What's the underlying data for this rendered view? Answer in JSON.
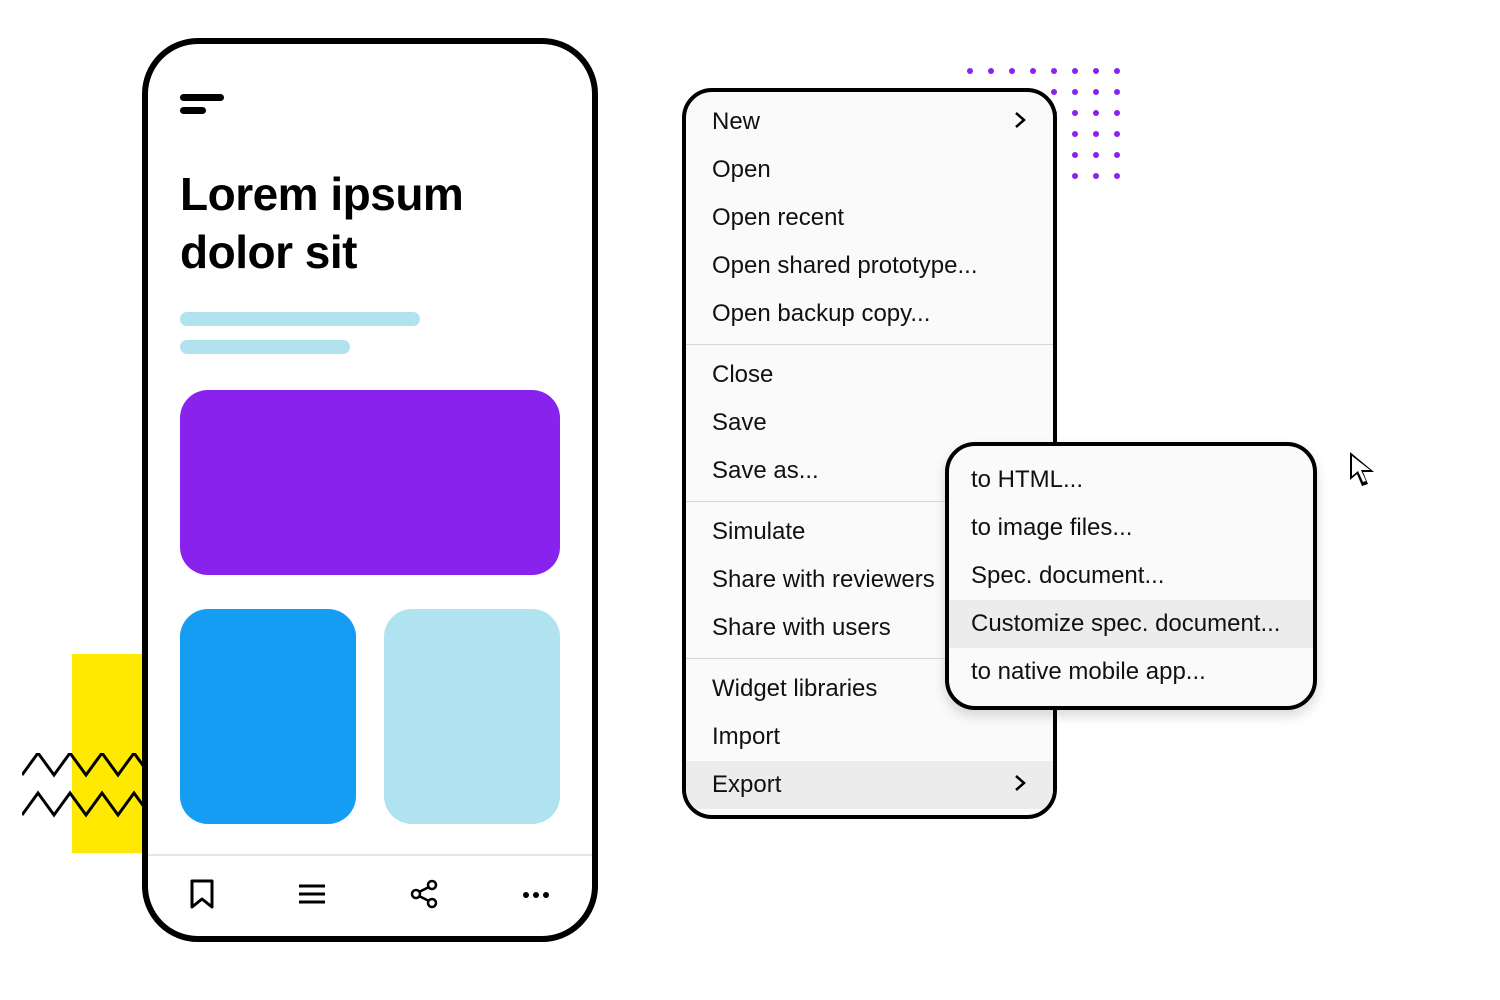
{
  "phone": {
    "title_line1": "Lorem ipsum",
    "title_line2": "dolor sit",
    "tabs": {
      "bookmark": "bookmark",
      "list": "list",
      "share": "share",
      "more": "more"
    }
  },
  "menu": {
    "groups": [
      {
        "items": [
          {
            "label": "New",
            "has_sub": true
          },
          {
            "label": "Open"
          },
          {
            "label": "Open recent"
          },
          {
            "label": "Open shared prototype..."
          },
          {
            "label": "Open backup copy..."
          }
        ]
      },
      {
        "items": [
          {
            "label": "Close"
          },
          {
            "label": "Save"
          },
          {
            "label": "Save as..."
          }
        ]
      },
      {
        "items": [
          {
            "label": "Simulate"
          },
          {
            "label": "Share with reviewers"
          },
          {
            "label": "Share with users"
          }
        ]
      },
      {
        "items": [
          {
            "label": "Widget libraries"
          },
          {
            "label": "Import"
          },
          {
            "label": "Export",
            "has_sub": true,
            "hover": true
          }
        ]
      }
    ]
  },
  "submenu": {
    "items": [
      {
        "label": "to HTML..."
      },
      {
        "label": "to image files..."
      },
      {
        "label": "Spec. document..."
      },
      {
        "label": "Customize spec. document...",
        "hover": true
      },
      {
        "label": "to native mobile app..."
      }
    ]
  },
  "colors": {
    "purple": "#8a22ed",
    "blue": "#159df4",
    "lightblue": "#b0e3ef",
    "yellow": "#ffe900",
    "dotPurple": "#8a22ed"
  }
}
